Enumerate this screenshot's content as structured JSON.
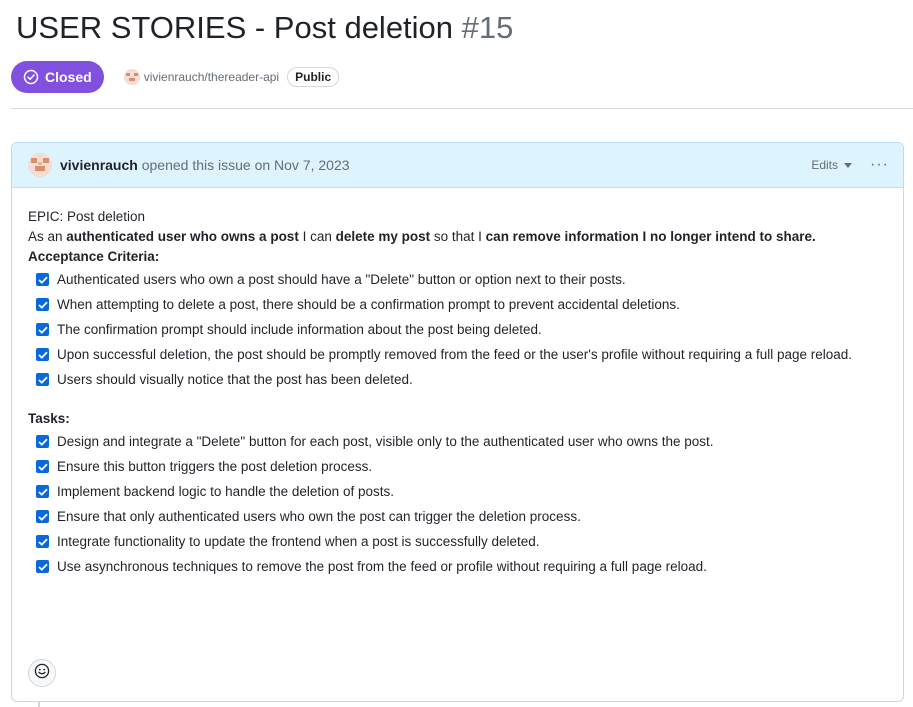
{
  "issue": {
    "title": "USER STORIES - Post deletion",
    "number": "#15",
    "state": "Closed",
    "repo": "vivienrauch/thereader-api",
    "visibility": "Public"
  },
  "comment": {
    "author": "vivienrauch",
    "opened_text": "opened this issue on Nov 7, 2023",
    "edits_label": "Edits",
    "more_label": "···",
    "epic": "EPIC: Post deletion",
    "story": {
      "p1": "As an ",
      "b1": "authenticated user who owns a post",
      "p2": " I can ",
      "b2": "delete my post",
      "p3": " so that I ",
      "b3": "can remove information I no longer intend to share."
    },
    "acceptance_heading": "Acceptance Criteria:",
    "acceptance": [
      "Authenticated users who own a post should have a \"Delete\" button or option next to their posts.",
      "When attempting to delete a post, there should be a confirmation prompt to prevent accidental deletions.",
      "The confirmation prompt should include information about the post being deleted.",
      "Upon successful deletion, the post should be promptly removed from the feed or the user's profile without requiring a full page reload.",
      "Users should visually notice that the post has been deleted."
    ],
    "tasks_heading": "Tasks:",
    "tasks": [
      "Design and integrate a \"Delete\" button for each post, visible only to the authenticated user who owns the post.",
      "Ensure this button triggers the post deletion process.",
      "Implement backend logic to handle the deletion of posts.",
      "Ensure that only authenticated users who own the post can trigger the deletion process.",
      "Integrate functionality to update the frontend when a post is successfully deleted.",
      "Use asynchronous techniques to remove the post from the feed or profile without requiring a full page reload."
    ]
  },
  "icons": {
    "state": "closed-check-circle-icon",
    "checkbox": "checked-checkbox-icon",
    "reaction": "smiley-icon",
    "dropdown": "triangle-down-icon"
  },
  "colors": {
    "closed_badge": "#8250df",
    "header_bg": "#ddf4ff",
    "checkbox": "#0969da"
  }
}
